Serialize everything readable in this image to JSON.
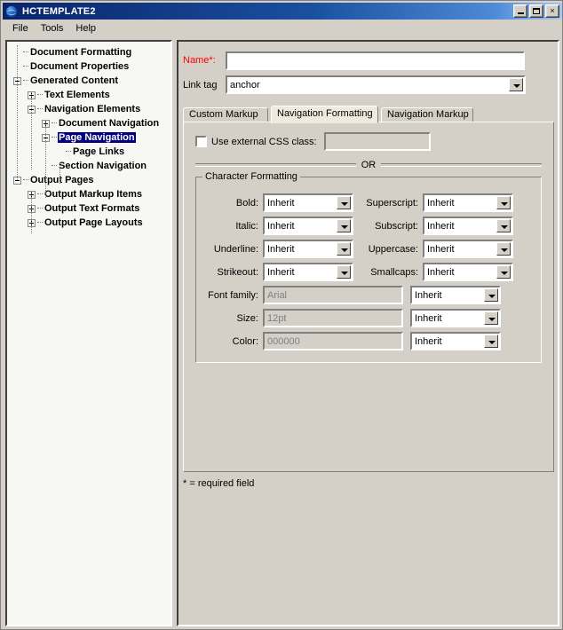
{
  "window": {
    "title": "HCTEMPLATE2",
    "app_icon": "globe-icon",
    "minimize_label": "",
    "maximize_label": "",
    "close_label": "×",
    "titlebar_color": "#0a246a",
    "face_color": "#d4d0c8"
  },
  "menu": {
    "items": [
      {
        "label": "File"
      },
      {
        "label": "Tools"
      },
      {
        "label": "Help"
      }
    ]
  },
  "tree": {
    "selected": "Page Navigation",
    "selection_color": "#000080",
    "items": [
      {
        "label": "Document Formatting",
        "indent": 0,
        "expander": "none"
      },
      {
        "label": "Document Properties",
        "indent": 0,
        "expander": "none"
      },
      {
        "label": "Generated Content",
        "indent": 0,
        "expander": "minus"
      },
      {
        "label": "Text Elements",
        "indent": 1,
        "expander": "plus"
      },
      {
        "label": "Navigation Elements",
        "indent": 1,
        "expander": "minus"
      },
      {
        "label": "Document Navigation",
        "indent": 2,
        "expander": "plus"
      },
      {
        "label": "Page Navigation",
        "indent": 2,
        "expander": "minus",
        "selected": true
      },
      {
        "label": "Page Links",
        "indent": 3,
        "expander": "none"
      },
      {
        "label": "Section Navigation",
        "indent": 2,
        "expander": "none"
      },
      {
        "label": "Output Pages",
        "indent": 0,
        "expander": "minus"
      },
      {
        "label": "Output Markup Items",
        "indent": 1,
        "expander": "plus"
      },
      {
        "label": "Output Text Formats",
        "indent": 1,
        "expander": "plus"
      },
      {
        "label": "Output Page Layouts",
        "indent": 1,
        "expander": "plus"
      }
    ]
  },
  "form": {
    "name_label": "Name*:",
    "name_label_color": "#ff0000",
    "name_value": "",
    "name_placeholder": "",
    "help_button_label": "?",
    "link_tag_label": "Link tag",
    "link_tag_value": "anchor",
    "required_note": "* = required field"
  },
  "tabs": {
    "items": [
      {
        "label": "Custom Markup",
        "active": false
      },
      {
        "label": "Navigation Formatting",
        "active": true
      },
      {
        "label": "Navigation Markup",
        "active": false
      }
    ]
  },
  "panel": {
    "use_external_css_label": "Use external CSS class:",
    "use_external_css_checked": false,
    "css_class_value": "",
    "or_label": "OR",
    "group_title": "Character Formatting",
    "inherit_value": "Inherit",
    "left_column": [
      {
        "label": "Bold:",
        "value": "Inherit",
        "type": "combo"
      },
      {
        "label": "Italic:",
        "value": "Inherit",
        "type": "combo"
      },
      {
        "label": "Underline:",
        "value": "Inherit",
        "type": "combo"
      },
      {
        "label": "Strikeout:",
        "value": "Inherit",
        "type": "combo"
      }
    ],
    "right_column": [
      {
        "label": "Superscript:",
        "value": "Inherit",
        "type": "combo"
      },
      {
        "label": "Subscript:",
        "value": "Inherit",
        "type": "combo"
      },
      {
        "label": "Uppercase:",
        "value": "Inherit",
        "type": "combo"
      },
      {
        "label": "Smallcaps:",
        "value": "Inherit",
        "type": "combo"
      }
    ],
    "wide_rows": [
      {
        "label": "Font family:",
        "value": "Arial",
        "disabled": true,
        "mode": "Inherit"
      },
      {
        "label": "Size:",
        "value": "12pt",
        "disabled": true,
        "mode": "Inherit"
      },
      {
        "label": "Color:",
        "value": "000000",
        "disabled": true,
        "mode": "Inherit"
      }
    ]
  }
}
